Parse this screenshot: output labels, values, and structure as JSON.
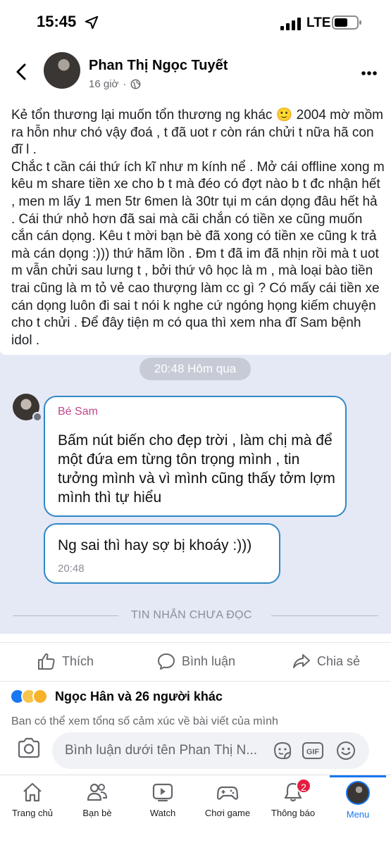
{
  "status_bar": {
    "time": "15:45",
    "network": "LTE",
    "icons": [
      "location-arrow-icon",
      "signal-icon",
      "battery-icon"
    ]
  },
  "post": {
    "author": "Phan Thị Ngọc Tuyết",
    "time_ago": "16 giờ",
    "audience_icon": "globe-icon",
    "text_p1": "Kẻ tổn thương lại muốn tổn thương ng khác 🙂 2004 mờ mồm ra hỗn như chó vậy đoá , t đã uot r còn rán chửi t nữa hã con đĩ l .",
    "text_p2": "Chắc t cần cái thứ ích kĩ như m kính nể . Mở cái offline xong m kêu m share tiền xe cho b t mà đéo có đợt nào b t đc nhận hết , men m lấy 1 men 5tr 6men là 30tr tụi m cán dọng đâu hết hả . Cái thứ nhỏ hơn đã sai mà cãi chắn có tiền xe cũng muốn cắn cán dọng. Kêu t mời bạn bè đã xong có tiền xe cũng k trả mà cán dọng :))) thứ hãm lồn . Đm t đã im đã nhịn rồi mà t uot m vẫn chửi sau lưng t , bởi thứ vô học là m , mà loại bào tiền trai cũng là m tỏ vẻ cao thượng làm cc gì ? Có mấy cái tiền xe cán dọng luôn đi sai t nói k nghe cứ ngóng họng kiếm chuyện cho t chửi . Để đây tiện m có qua thì xem nha đĩ Sam bệnh idol ."
  },
  "screenshot": {
    "timestamp_pill": "20:48 Hôm qua",
    "sender_name": "Bé Sam",
    "message_1": "Bấm nút biến cho đẹp trời , làm chị mà để một đứa em từng tôn trọng mình , tin tưởng mình và vì mình cũng thấy tởm lợm mình thì tự hiểu",
    "message_2": "Ng sai thì hay sợ bị khoáy :)))",
    "message_2_time": "20:48",
    "unread_divider": "TIN NHẮN CHƯA ĐỌC"
  },
  "actions": {
    "like": "Thích",
    "comment": "Bình luận",
    "share": "Chia sẻ"
  },
  "reactions": {
    "types": [
      "like",
      "haha",
      "sad"
    ],
    "summary": "Ngọc Hân và 26 người khác",
    "hint": "Bạn có thể xem tổng số cảm xúc về bài viết của mình"
  },
  "composer": {
    "placeholder": "Bình luận dưới tên Phan Thị N...",
    "gif_label": "GIF"
  },
  "tabs": [
    {
      "label": "Trang chủ",
      "icon": "home-icon"
    },
    {
      "label": "Bạn bè",
      "icon": "friends-icon"
    },
    {
      "label": "Watch",
      "icon": "watch-icon"
    },
    {
      "label": "Chơi game",
      "icon": "gamepad-icon"
    },
    {
      "label": "Thông báo",
      "icon": "bell-icon",
      "badge": "2"
    },
    {
      "label": "Menu",
      "icon": "menu-avatar",
      "active": true
    }
  ],
  "colors": {
    "accent": "#1877f2",
    "bubble_border": "#2f88c5",
    "sender_name": "#c4468a",
    "badge": "#e41e3f"
  }
}
